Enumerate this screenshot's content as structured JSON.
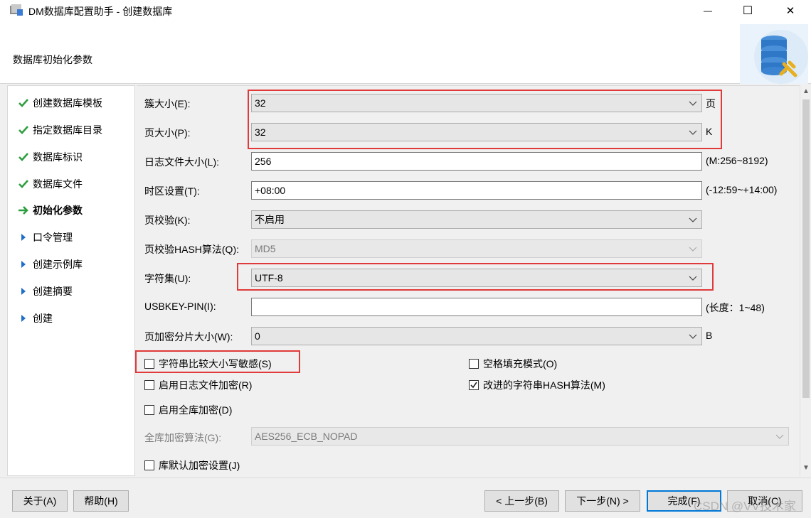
{
  "window": {
    "title": "DM数据库配置助手 - 创建数据库",
    "controls": {
      "minimize": "—",
      "maximize": "☐",
      "close": "✕"
    }
  },
  "header": {
    "title": "数据库初始化参数",
    "logo_icon": "database-gear-icon"
  },
  "steps": [
    {
      "label": "创建数据库模板",
      "state": "done"
    },
    {
      "label": "指定数据库目录",
      "state": "done"
    },
    {
      "label": "数据库标识",
      "state": "done"
    },
    {
      "label": "数据库文件",
      "state": "done"
    },
    {
      "label": "初始化参数",
      "state": "current"
    },
    {
      "label": "口令管理",
      "state": "pending"
    },
    {
      "label": "创建示例库",
      "state": "pending"
    },
    {
      "label": "创建摘要",
      "state": "pending"
    },
    {
      "label": "创建",
      "state": "pending"
    }
  ],
  "form": {
    "extent_size": {
      "label": "簇大小(E):",
      "value": "32",
      "unit": "页"
    },
    "page_size": {
      "label": "页大小(P):",
      "value": "32",
      "unit": "K"
    },
    "log_size": {
      "label": "日志文件大小(L):",
      "value": "256",
      "hint": "(M:256~8192)"
    },
    "time_zone": {
      "label": "时区设置(T):",
      "value": "+08:00",
      "hint": "(-12:59~+14:00)"
    },
    "page_check": {
      "label": "页校验(K):",
      "value": "不启用"
    },
    "page_check_hash": {
      "label": "页校验HASH算法(Q):",
      "value": "MD5"
    },
    "charset": {
      "label": "字符集(U):",
      "value": "UTF-8"
    },
    "usbkey_pin": {
      "label": "USBKEY-PIN(I):",
      "value": "",
      "hint": "(长度：1~48)"
    },
    "page_enc_slice": {
      "label": "页加密分片大小(W):",
      "value": "0",
      "unit": "B"
    },
    "case_sensitive": {
      "label": "字符串比较大小写敏感(S)",
      "checked": false
    },
    "blank_pad_mode": {
      "label": "空格填充模式(O)",
      "checked": false
    },
    "log_encrypt": {
      "label": "启用日志文件加密(R)",
      "checked": false
    },
    "improved_hash": {
      "label": "改进的字符串HASH算法(M)",
      "checked": true
    },
    "full_db_encrypt": {
      "label": "启用全库加密(D)",
      "checked": false
    },
    "full_db_enc_algo": {
      "label": "全库加密算法(G):",
      "value": "AES256_ECB_NOPAD"
    },
    "default_enc_settings": {
      "label": "库默认加密设置(J)",
      "checked": false
    }
  },
  "footer": {
    "about": "关于(A)",
    "help": "帮助(H)",
    "prev": "< 上一步(B)",
    "next": "下一步(N) >",
    "finish": "完成(F)",
    "cancel": "取消(C)"
  },
  "watermark": "CSDN @VV技术家",
  "colors": {
    "highlight_border": "#e03a3a",
    "check_green": "#2e9e3f",
    "arrow_blue": "#1e6fc8",
    "primary_border": "#0078d7"
  }
}
